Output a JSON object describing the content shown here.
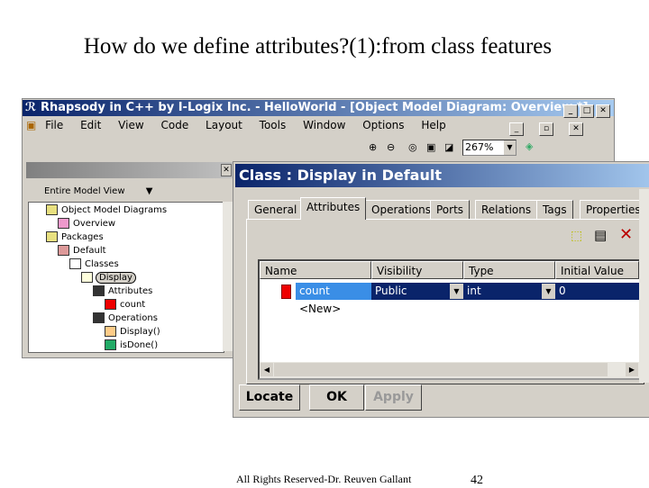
{
  "slide": {
    "title": "How do we define attributes?(1):from class features",
    "footer": "All Rights Reserved-Dr. Reuven Gallant",
    "page": "42"
  },
  "main_window": {
    "title": "Rhapsody in C++ by I-Logix Inc. - HelloWorld - [Object Model Diagram: Overview *]",
    "menu": [
      "File",
      "Edit",
      "View",
      "Code",
      "Layout",
      "Tools",
      "Window",
      "Options",
      "Help"
    ],
    "zoom": "267%"
  },
  "browser": {
    "view": "Entire Model View",
    "tree": [
      {
        "label": "Object Model Diagrams",
        "depth": 1,
        "icon": "folder-icon"
      },
      {
        "label": "Overview",
        "depth": 2,
        "icon": "diagram-icon"
      },
      {
        "label": "Packages",
        "depth": 1,
        "icon": "folder-icon"
      },
      {
        "label": "Default",
        "depth": 2,
        "icon": "package-icon"
      },
      {
        "label": "Classes",
        "depth": 3,
        "icon": "classes-icon"
      },
      {
        "label": "Display",
        "depth": 4,
        "icon": "class-icon"
      },
      {
        "label": "Attributes",
        "depth": 5,
        "icon": "attributes-icon"
      },
      {
        "label": "count",
        "depth": 6,
        "icon": "attribute-icon"
      },
      {
        "label": "Operations",
        "depth": 5,
        "icon": "operations-icon"
      },
      {
        "label": "Display()",
        "depth": 6,
        "icon": "constructor-icon"
      },
      {
        "label": "isDone()",
        "depth": 6,
        "icon": "operation-icon"
      }
    ]
  },
  "dialog": {
    "title": "Class : Display in Default",
    "tabs": [
      "General",
      "Attributes",
      "Operations",
      "Ports",
      "Relations",
      "Tags",
      "Properties"
    ],
    "active_tab": "Attributes",
    "columns": [
      "Name",
      "Visibility",
      "Type",
      "Initial Value"
    ],
    "rows": [
      {
        "name": "count",
        "visibility": "Public",
        "type": "int",
        "initial": "0"
      }
    ],
    "new_row": "<New>",
    "buttons": {
      "locate": "Locate",
      "ok": "OK",
      "apply": "Apply"
    }
  }
}
